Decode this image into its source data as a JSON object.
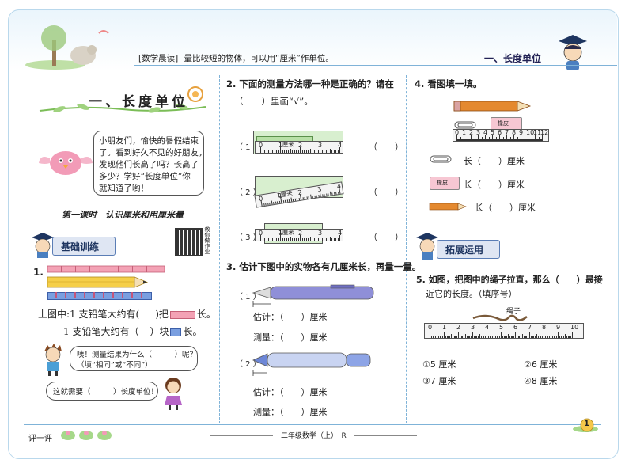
{
  "header": {
    "reading_tag": "[数学晨读]",
    "reading_text": "量比较短的物体，可以用“厘米”作单位。",
    "section_title": "一、长度单位"
  },
  "left": {
    "title": "一、长度单位",
    "bubble_text": [
      "小朋友们，愉快的暑假结束",
      "了。看到好久不见的好朋友，",
      "发现他们长高了吗？长高了",
      "多少？学好“长度单位”你",
      "就知道了哟！"
    ],
    "lesson_title": "第一课时　认识厘米和用厘米量",
    "qr_label": "教你做作业",
    "basic_label": "基础训练",
    "q1_num": "1.",
    "q1_line1_a": "上图中:1 支铅笔大约有(",
    "q1_line1_b": ")把",
    "q1_line1_c": "长。",
    "q1_line2_a": "1 支铅笔大约有（",
    "q1_line2_b": "）块",
    "q1_line2_c": "长。",
    "boy_bubble": [
      "咦！测量结果为什么（　　　）呢？",
      "（填“相同”或“不同”）"
    ],
    "girl_bubble": "这就需要（　　　）长度单位！"
  },
  "mid": {
    "q2_line1": "2. 下面的测量方法哪一种是正确的？请在",
    "q2_line2": "（　　）里画“√”。",
    "options": [
      "（ 1 ）",
      "（ 2 ）",
      "（ 3 ）"
    ],
    "answer_paren": "（　　）",
    "q3": "3. 估计下图中的实物各有几厘米长，再量一量。",
    "item1": "（ 1 ）",
    "item2": "（ 2 ）",
    "estimate": "估计：（　　）厘米",
    "measure": "测量：（　　）厘米",
    "ruler_unit": "1厘米"
  },
  "right": {
    "q4": "4. 看图填一填。",
    "eraser_label": "橡皮",
    "len1": "长（　　）厘米",
    "len2": "长（　　）厘米",
    "len3": "长（　　）厘米",
    "expand_label": "拓展运用",
    "q5_line1": "5. 如图，把图中的绳子拉直，那么（　　）最接",
    "q5_line2": "近它的长度。（填序号）",
    "rope_label": "绳子",
    "choices": [
      "①5 厘米",
      "②6 厘米",
      "③7 厘米",
      "④8 厘米"
    ]
  },
  "footer": {
    "rating": "评一评",
    "book": "二年级数学（上）　R",
    "page": "1"
  },
  "ruler_small": [
    "0",
    "1",
    "2",
    "3",
    "4"
  ],
  "ruler_long": [
    "0",
    "1",
    "2",
    "3",
    "4",
    "5",
    "6",
    "7",
    "8",
    "9",
    "10"
  ],
  "ruler_q4": [
    "0",
    "1",
    "2",
    "3",
    "4",
    "5",
    "6",
    "7",
    "8",
    "9",
    "10",
    "11",
    "12"
  ]
}
